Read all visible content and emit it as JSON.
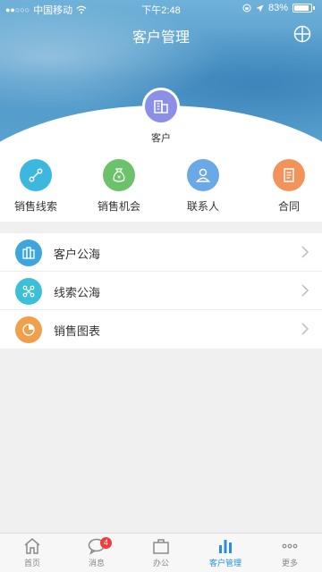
{
  "status_bar": {
    "carrier": "中国移动",
    "time": "下午2:48",
    "battery": "83%"
  },
  "header": {
    "title": "客户管理",
    "customer_label": "客户"
  },
  "shortcuts": [
    {
      "label": "销售线索",
      "color": "#3bb7e0",
      "icon": "link-icon"
    },
    {
      "label": "销售机会",
      "color": "#6cc26a",
      "icon": "money-bag-icon"
    },
    {
      "label": "联系人",
      "color": "#6aa9e6",
      "icon": "person-icon"
    },
    {
      "label": "合同",
      "color": "#f2935a",
      "icon": "document-icon"
    }
  ],
  "list": [
    {
      "label": "客户公海",
      "color": "#3ca6dd",
      "icon": "buildings-icon"
    },
    {
      "label": "线索公海",
      "color": "#3cc0d6",
      "icon": "network-icon"
    },
    {
      "label": "销售图表",
      "color": "#f0a04b",
      "icon": "pie-chart-icon"
    }
  ],
  "tabbar": {
    "items": [
      {
        "label": "首页",
        "icon": "home-icon"
      },
      {
        "label": "消息",
        "icon": "chat-icon",
        "badge": "4"
      },
      {
        "label": "办公",
        "icon": "briefcase-icon"
      },
      {
        "label": "客户管理",
        "icon": "bar-chart-icon",
        "active": true
      },
      {
        "label": "更多",
        "icon": "more-icon"
      }
    ]
  },
  "colors": {
    "accent": "#2a8fd6",
    "header_blue": "#4d97c8",
    "customer_avatar": "#8b8fe6"
  }
}
